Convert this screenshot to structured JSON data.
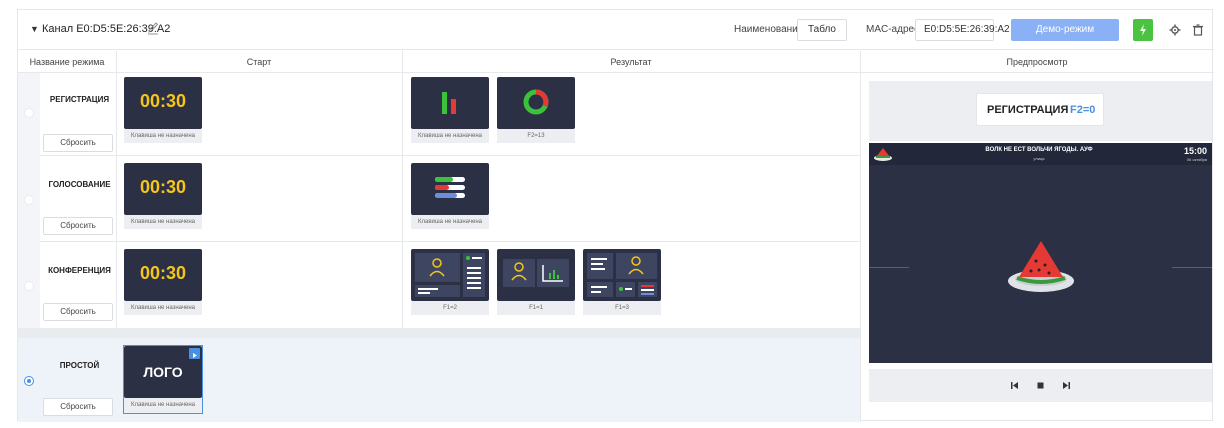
{
  "channel": {
    "title": "Канал E0:D5:5E:26:39:A2",
    "name_label": "Наименование:",
    "name_value": "Табло",
    "mac_label": "MAC-адрес:",
    "mac_value": "E0:D5:5E:26:39:A2",
    "demo_button": "Демо-режим"
  },
  "headers": {
    "mode_name": "Название режима",
    "start": "Старт",
    "result": "Результат",
    "preview": "Предпросмотр"
  },
  "reset_label": "Сбросить",
  "rows": [
    {
      "name": "РЕГИСТРАЦИЯ",
      "selected": false,
      "start": {
        "timer": "00:30",
        "key": "Клавиша не назначена"
      },
      "results": [
        {
          "kind": "bars-icon",
          "key": "Клавиша не назначена"
        },
        {
          "kind": "donut-icon",
          "key": "F2=13"
        }
      ]
    },
    {
      "name": "ГОЛОСОВАНИЕ",
      "selected": false,
      "start": {
        "timer": "00:30",
        "key": "Клавиша не назначена"
      },
      "results": [
        {
          "kind": "progress-bars-icon",
          "key": "Клавиша не назначена"
        }
      ]
    },
    {
      "name": "КОНФЕРЕНЦИЯ",
      "selected": false,
      "start": {
        "timer": "00:30",
        "key": "Клавиша не назначена"
      },
      "results": [
        {
          "kind": "speaker-layout-icon",
          "key": "F1=2"
        },
        {
          "kind": "speaker-chart-layout-icon",
          "key": "F1=1"
        },
        {
          "kind": "grid-layout-icon",
          "key": "F1=3"
        }
      ]
    },
    {
      "name": "ПРОСТОЙ",
      "selected": true,
      "start": {
        "logo": "ЛОГО",
        "key": "Клавиша не назначена"
      },
      "results": []
    }
  ],
  "preview": {
    "mode": "РЕГИСТРАЦИЯ",
    "hotkey": "F2=0",
    "video_title": "ВОЛК НЕ ЕСТ ВОЛЬЧИ ЯГОДЫ. АУФ",
    "video_time": "15:00",
    "video_date": "06 октября",
    "video_sub": "улица"
  },
  "colors": {
    "accent": "#4a90e2",
    "demo_button": "#8ab0f5",
    "green_button": "#4cc242",
    "thumb_bg": "#2b3044",
    "timer": "#f5c518",
    "selected_row": "#eef3f9"
  }
}
